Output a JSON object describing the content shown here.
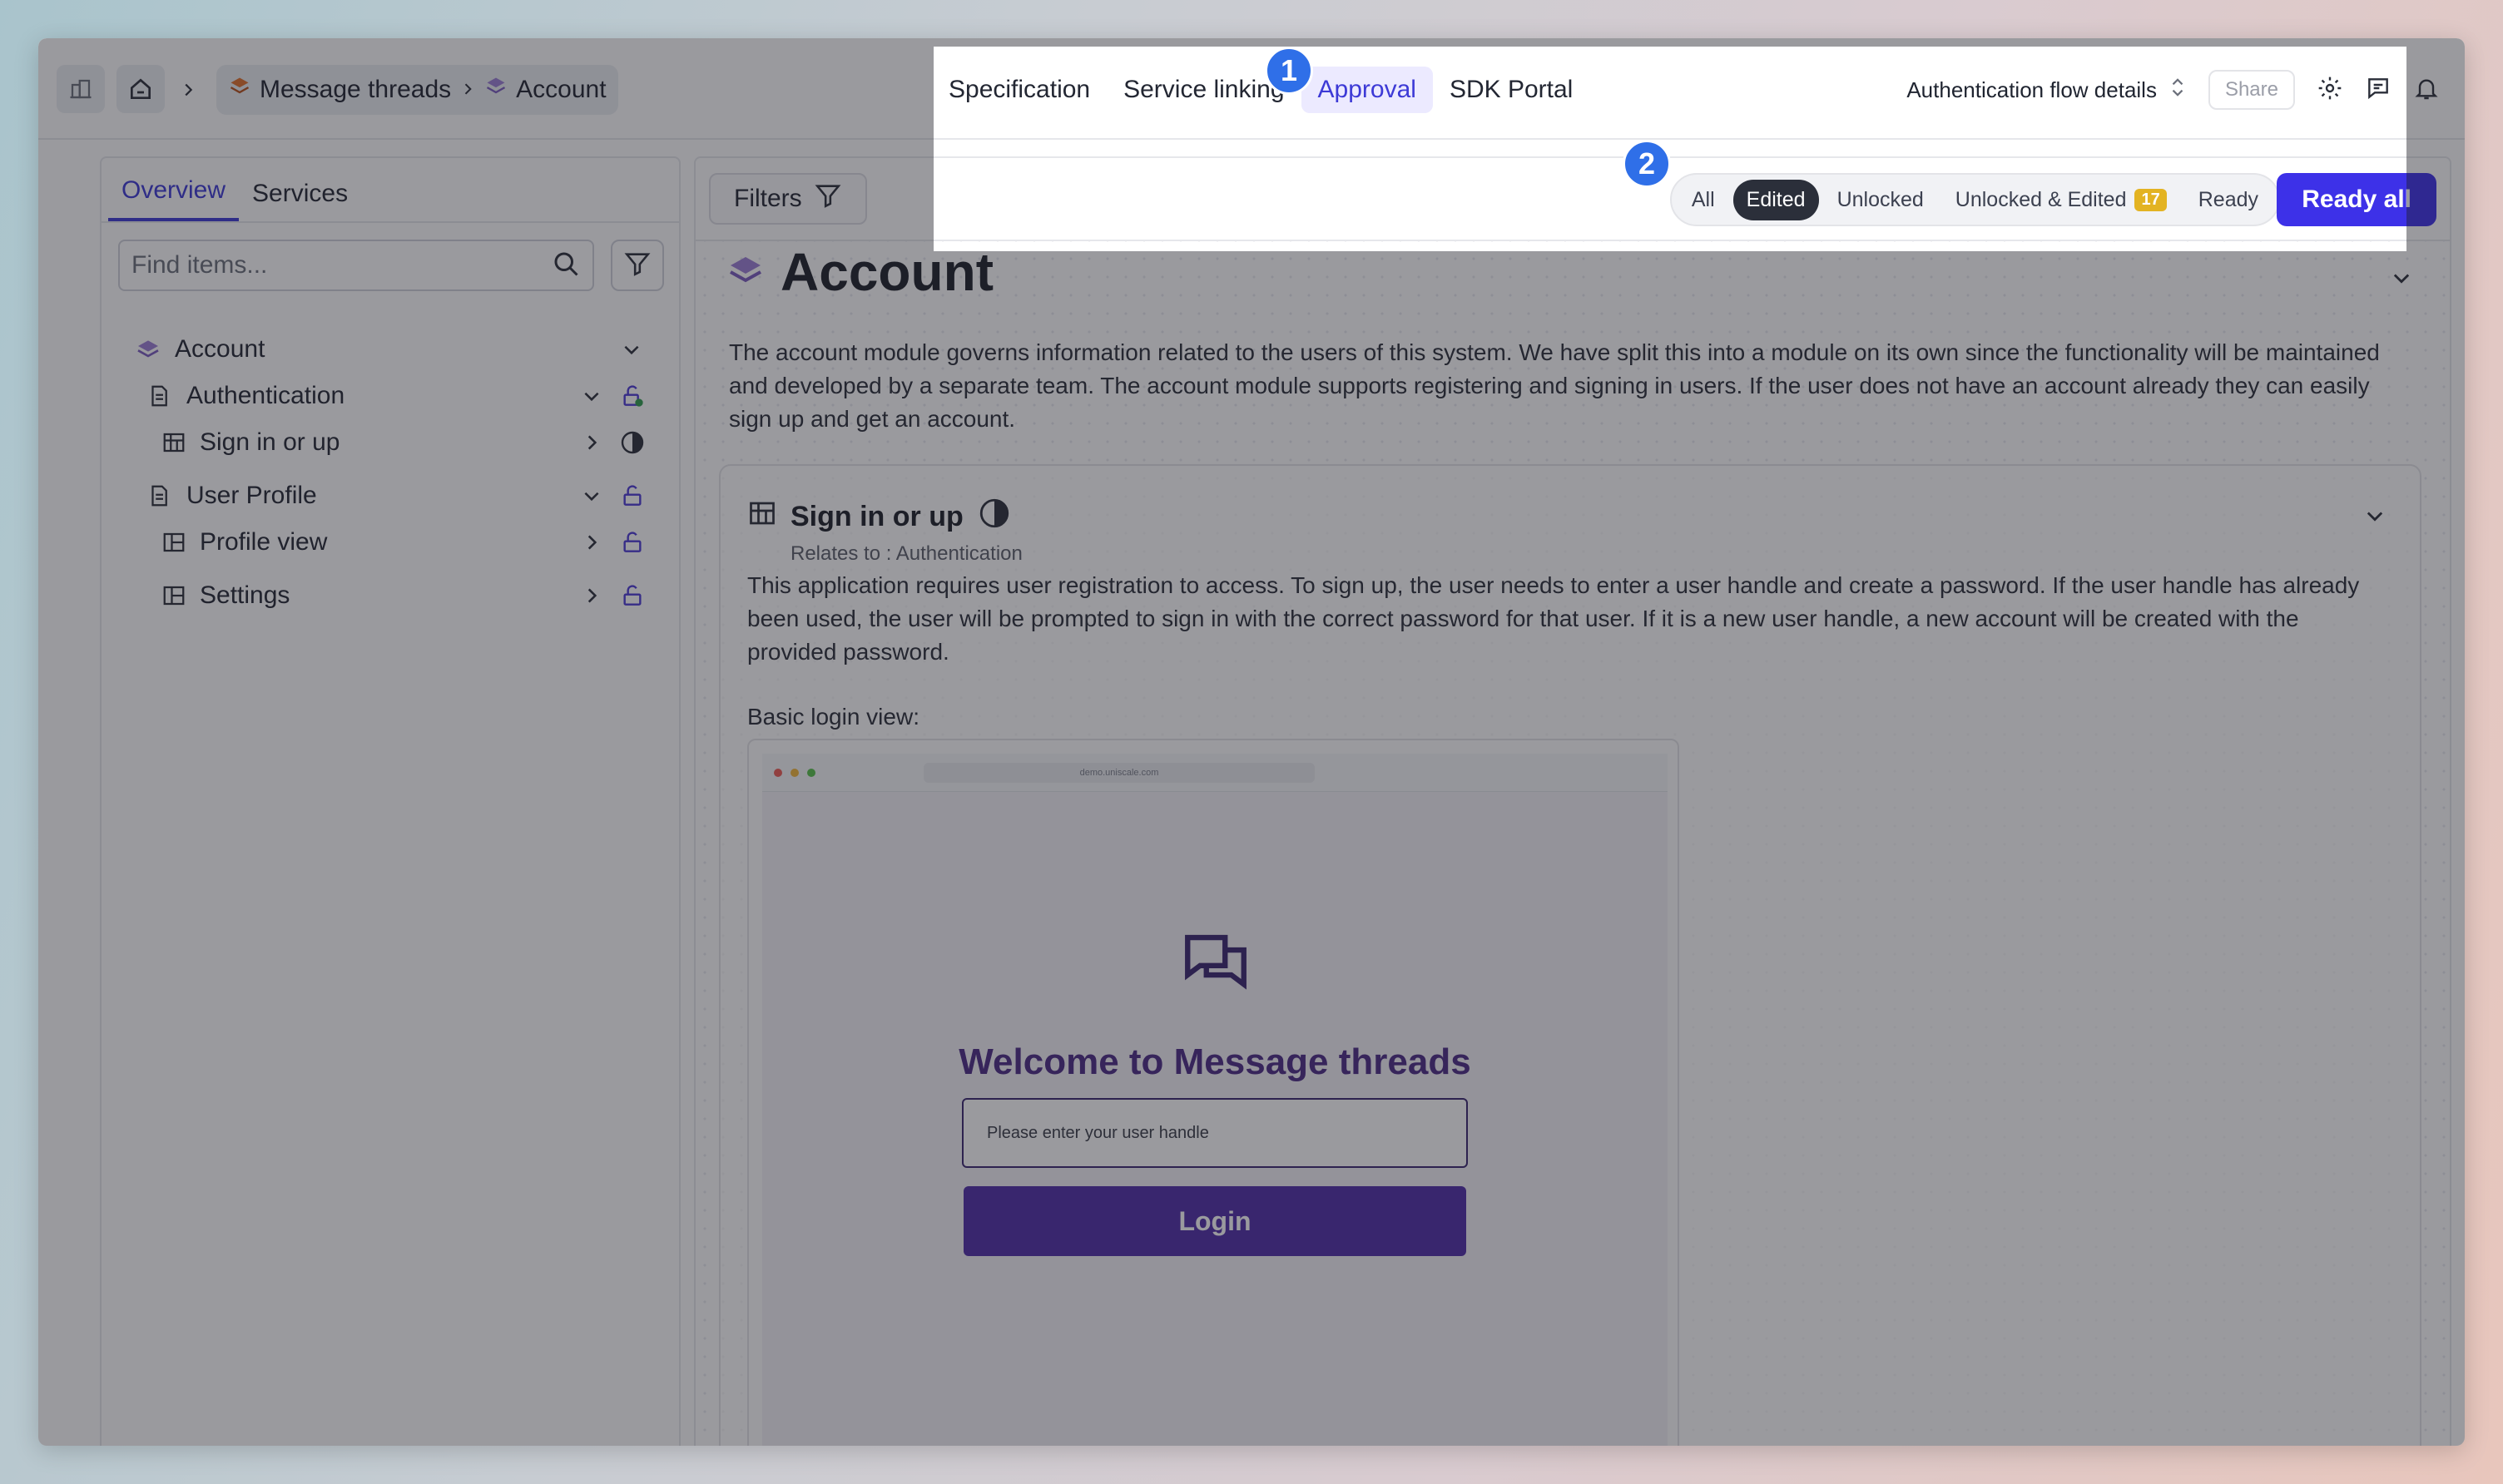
{
  "breadcrumb": {
    "project": "Message threads",
    "current": "Account"
  },
  "top_tabs": [
    {
      "label": "Specification"
    },
    {
      "label": "Service linking"
    },
    {
      "label": "Approval"
    },
    {
      "label": "SDK Portal"
    }
  ],
  "active_top_tab": "Approval",
  "flow_select": {
    "value": "Authentication flow details"
  },
  "share_label": "Share",
  "sidebar": {
    "tabs": [
      {
        "label": "Overview"
      },
      {
        "label": "Services"
      }
    ],
    "search_placeholder": "Find items...",
    "tree": [
      {
        "label": "Account"
      },
      {
        "label": "Authentication"
      },
      {
        "label": "Sign in or up"
      },
      {
        "label": "User Profile"
      },
      {
        "label": "Profile view"
      },
      {
        "label": "Settings"
      }
    ]
  },
  "main": {
    "filters_label": "Filters",
    "segments": [
      {
        "label": "All"
      },
      {
        "label": "Edited"
      },
      {
        "label": "Unlocked"
      },
      {
        "label": "Unlocked & Edited",
        "badge": "17"
      },
      {
        "label": "Ready"
      }
    ],
    "ready_all_label": "Ready all",
    "heading": "Account",
    "description": "The account module governs information related to the users of this system. We have split this into a module on its own since the functionality will be maintained and developed by a separate team. The account module supports registering and signing in users. If the user does not have an account already they can easily sign up and get an account.",
    "card": {
      "title": "Sign in or up",
      "relates": "Relates to : Authentication",
      "description": "This application requires user registration to access. To sign up, the user needs to enter a user handle and create a password. If the user handle has already been used, the user will be prompted to sign in with the correct password for that user. If it is a new user handle, a new account will be created with the provided password.",
      "basic_label": "Basic login view:",
      "preview": {
        "url": "demo.uniscale.com",
        "welcome": "Welcome to Message threads",
        "input_placeholder": "Please enter your user handle",
        "login_label": "Login"
      }
    }
  },
  "steps": [
    "1",
    "2"
  ],
  "colors": {
    "accent": "#3d31e8",
    "brand_purple": "#4b2a86",
    "step_blue": "#2f6fe8",
    "badge_yellow": "#e3b322"
  }
}
